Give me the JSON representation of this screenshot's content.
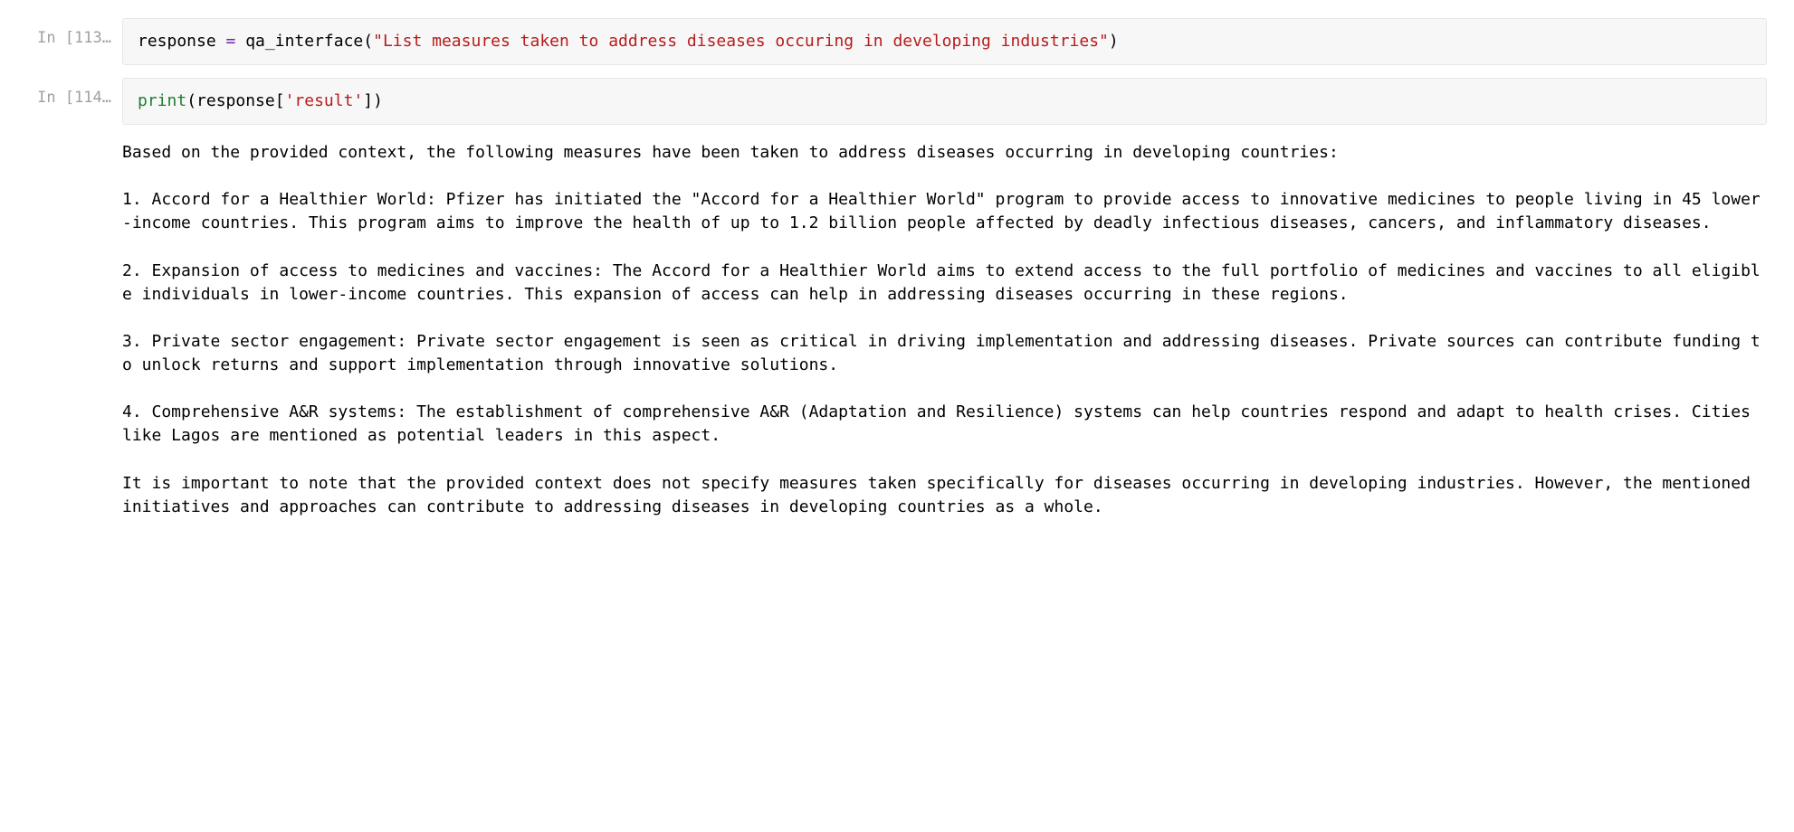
{
  "cells": [
    {
      "prompt": "In [113…",
      "code": {
        "var": "response",
        "op": " = ",
        "func": "qa_interface",
        "open": "(",
        "arg": "\"List measures taken to address diseases occuring in developing industries\"",
        "close": ")"
      }
    },
    {
      "prompt": "In [114…",
      "code": {
        "builtin": "print",
        "open": "(",
        "var": "response",
        "bracket_open": "[",
        "key": "'result'",
        "bracket_close": "]",
        "close": ")"
      },
      "output": "Based on the provided context, the following measures have been taken to address diseases occurring in developing countries:\n\n1. Accord for a Healthier World: Pfizer has initiated the \"Accord for a Healthier World\" program to provide access to innovative medicines to people living in 45 lower-income countries. This program aims to improve the health of up to 1.2 billion people affected by deadly infectious diseases, cancers, and inflammatory diseases.\n\n2. Expansion of access to medicines and vaccines: The Accord for a Healthier World aims to extend access to the full portfolio of medicines and vaccines to all eligible individuals in lower-income countries. This expansion of access can help in addressing diseases occurring in these regions.\n\n3. Private sector engagement: Private sector engagement is seen as critical in driving implementation and addressing diseases. Private sources can contribute funding to unlock returns and support implementation through innovative solutions.\n\n4. Comprehensive A&R systems: The establishment of comprehensive A&R (Adaptation and Resilience) systems can help countries respond and adapt to health crises. Cities like Lagos are mentioned as potential leaders in this aspect.\n\nIt is important to note that the provided context does not specify measures taken specifically for diseases occurring in developing industries. However, the mentioned initiatives and approaches can contribute to addressing diseases in developing countries as a whole."
    }
  ]
}
